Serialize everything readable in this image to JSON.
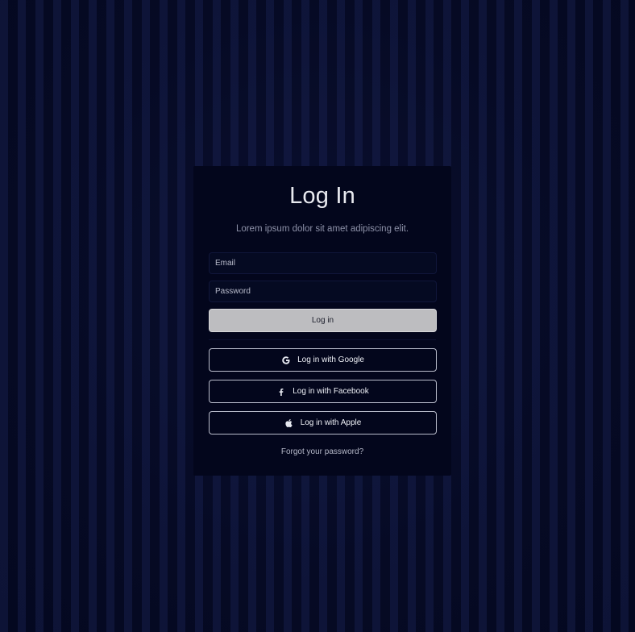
{
  "login": {
    "title": "Log In",
    "subtitle": "Lorem ipsum dolor sit amet adipiscing elit.",
    "email_placeholder": "Email",
    "password_placeholder": "Password",
    "submit_label": "Log in",
    "social": [
      {
        "label": "Log in with Google",
        "icon": "google-icon"
      },
      {
        "label": "Log in with Facebook",
        "icon": "facebook-icon"
      },
      {
        "label": "Log in with Apple",
        "icon": "apple-icon"
      }
    ],
    "forgot_label": "Forgot your password?"
  },
  "colors": {
    "background": "#050a24",
    "card": "#03061c",
    "primary_button": "#bdbdc0",
    "outline": "#b9bccb"
  }
}
